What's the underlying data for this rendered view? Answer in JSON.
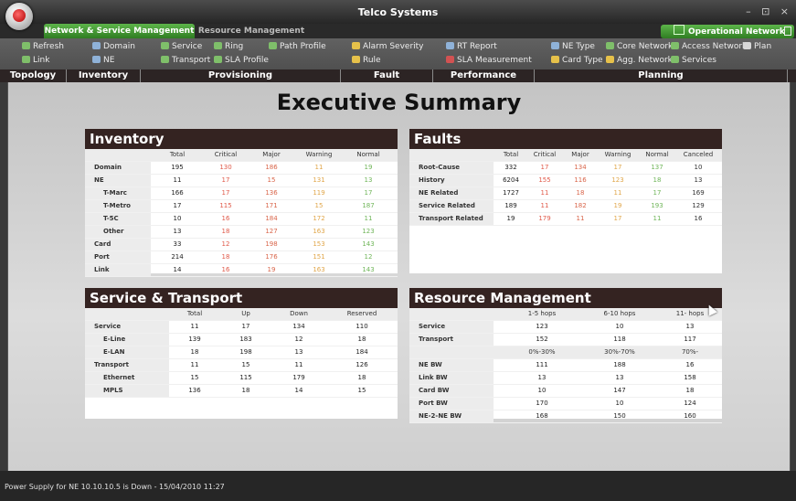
{
  "app": {
    "title": "Telco Systems",
    "controls": [
      "–",
      "⊡",
      "×"
    ]
  },
  "tabs": [
    {
      "label": "Network & Service Management"
    },
    {
      "label": "Resource Management"
    }
  ],
  "network_button": "Operational Network",
  "ribbon": {
    "topology": [
      "Refresh",
      "Link"
    ],
    "inventory": [
      "Domain",
      "NE"
    ],
    "provisioning": [
      "Service",
      "Ring",
      "Path Profile",
      "Transport",
      "SLA Profile"
    ],
    "fault": [
      "Alarm Severity",
      "Rule"
    ],
    "performance": [
      "RT Report",
      "SLA Measurement"
    ],
    "planning": [
      "NE Type",
      "Core Network",
      "Access Network",
      "Plan",
      "Card Type",
      "Agg. Network",
      "Services"
    ]
  },
  "groups": [
    "Topology",
    "Inventory",
    "Provisioning",
    "Fault",
    "Performance",
    "Planning"
  ],
  "heading": "Executive Summary",
  "inventory": {
    "title": "Inventory",
    "headers": [
      "Total",
      "Critical",
      "Major",
      "Warning",
      "Normal"
    ],
    "rows": [
      {
        "label": "Domain",
        "vals": [
          "195",
          "130",
          "186",
          "11",
          "19"
        ]
      },
      {
        "label": "NE",
        "vals": [
          "11",
          "17",
          "15",
          "131",
          "13"
        ]
      },
      {
        "label": "T-Marc",
        "vals": [
          "166",
          "17",
          "136",
          "119",
          "17"
        ]
      },
      {
        "label": "T-Metro",
        "vals": [
          "17",
          "115",
          "171",
          "15",
          "187"
        ]
      },
      {
        "label": "T-5C",
        "vals": [
          "10",
          "16",
          "184",
          "172",
          "11"
        ]
      },
      {
        "label": "Other",
        "vals": [
          "13",
          "18",
          "127",
          "163",
          "123"
        ]
      },
      {
        "label": "Card",
        "vals": [
          "33",
          "12",
          "198",
          "153",
          "143"
        ]
      },
      {
        "label": "Port",
        "vals": [
          "214",
          "18",
          "176",
          "151",
          "12"
        ]
      },
      {
        "label": "Link",
        "vals": [
          "14",
          "16",
          "19",
          "163",
          "143"
        ]
      }
    ]
  },
  "faults": {
    "title": "Faults",
    "headers": [
      "Total",
      "Critical",
      "Major",
      "Warning",
      "Normal",
      "Canceled"
    ],
    "rows": [
      {
        "label": "Root-Cause",
        "vals": [
          "332",
          "17",
          "134",
          "17",
          "137",
          "10"
        ]
      },
      {
        "label": "History",
        "vals": [
          "6204",
          "155",
          "116",
          "123",
          "18",
          "13"
        ]
      },
      {
        "label": "NE Related",
        "vals": [
          "1727",
          "11",
          "18",
          "11",
          "17",
          "169"
        ]
      },
      {
        "label": "Service Related",
        "vals": [
          "189",
          "11",
          "182",
          "19",
          "193",
          "129"
        ]
      },
      {
        "label": "Transport Related",
        "vals": [
          "19",
          "179",
          "11",
          "17",
          "11",
          "16"
        ]
      }
    ]
  },
  "service_transport": {
    "title": "Service & Transport",
    "headers": [
      "Total",
      "Up",
      "Down",
      "Reserved"
    ],
    "rows": [
      {
        "label": "Service",
        "vals": [
          "11",
          "17",
          "134",
          "110"
        ]
      },
      {
        "label": "E-Line",
        "vals": [
          "139",
          "183",
          "12",
          "18"
        ]
      },
      {
        "label": "E-LAN",
        "vals": [
          "18",
          "198",
          "13",
          "184"
        ]
      },
      {
        "label": "Transport",
        "vals": [
          "11",
          "15",
          "11",
          "126"
        ]
      },
      {
        "label": "Ethernet",
        "vals": [
          "15",
          "115",
          "179",
          "18"
        ]
      },
      {
        "label": "MPLS",
        "vals": [
          "136",
          "18",
          "14",
          "15"
        ]
      }
    ]
  },
  "resource": {
    "title": "Resource Management",
    "hop_headers": [
      "1-5 hops",
      "6-10 hops",
      "11- hops"
    ],
    "hop_rows": [
      {
        "label": "Service",
        "vals": [
          "123",
          "10",
          "13"
        ]
      },
      {
        "label": "Transport",
        "vals": [
          "152",
          "118",
          "117"
        ]
      }
    ],
    "pct_headers": [
      "0%-30%",
      "30%-70%",
      "70%-"
    ],
    "pct_rows": [
      {
        "label": "NE BW",
        "vals": [
          "111",
          "188",
          "16"
        ]
      },
      {
        "label": "Link BW",
        "vals": [
          "13",
          "13",
          "158"
        ]
      },
      {
        "label": "Card BW",
        "vals": [
          "10",
          "147",
          "18"
        ]
      },
      {
        "label": "Port BW",
        "vals": [
          "170",
          "10",
          "124"
        ]
      },
      {
        "label": "NE-2-NE BW",
        "vals": [
          "168",
          "150",
          "160"
        ]
      }
    ]
  },
  "status": {
    "text": "Power Supply for NE 10.10.10.5 is Down - 15/04/2010  11:27"
  }
}
